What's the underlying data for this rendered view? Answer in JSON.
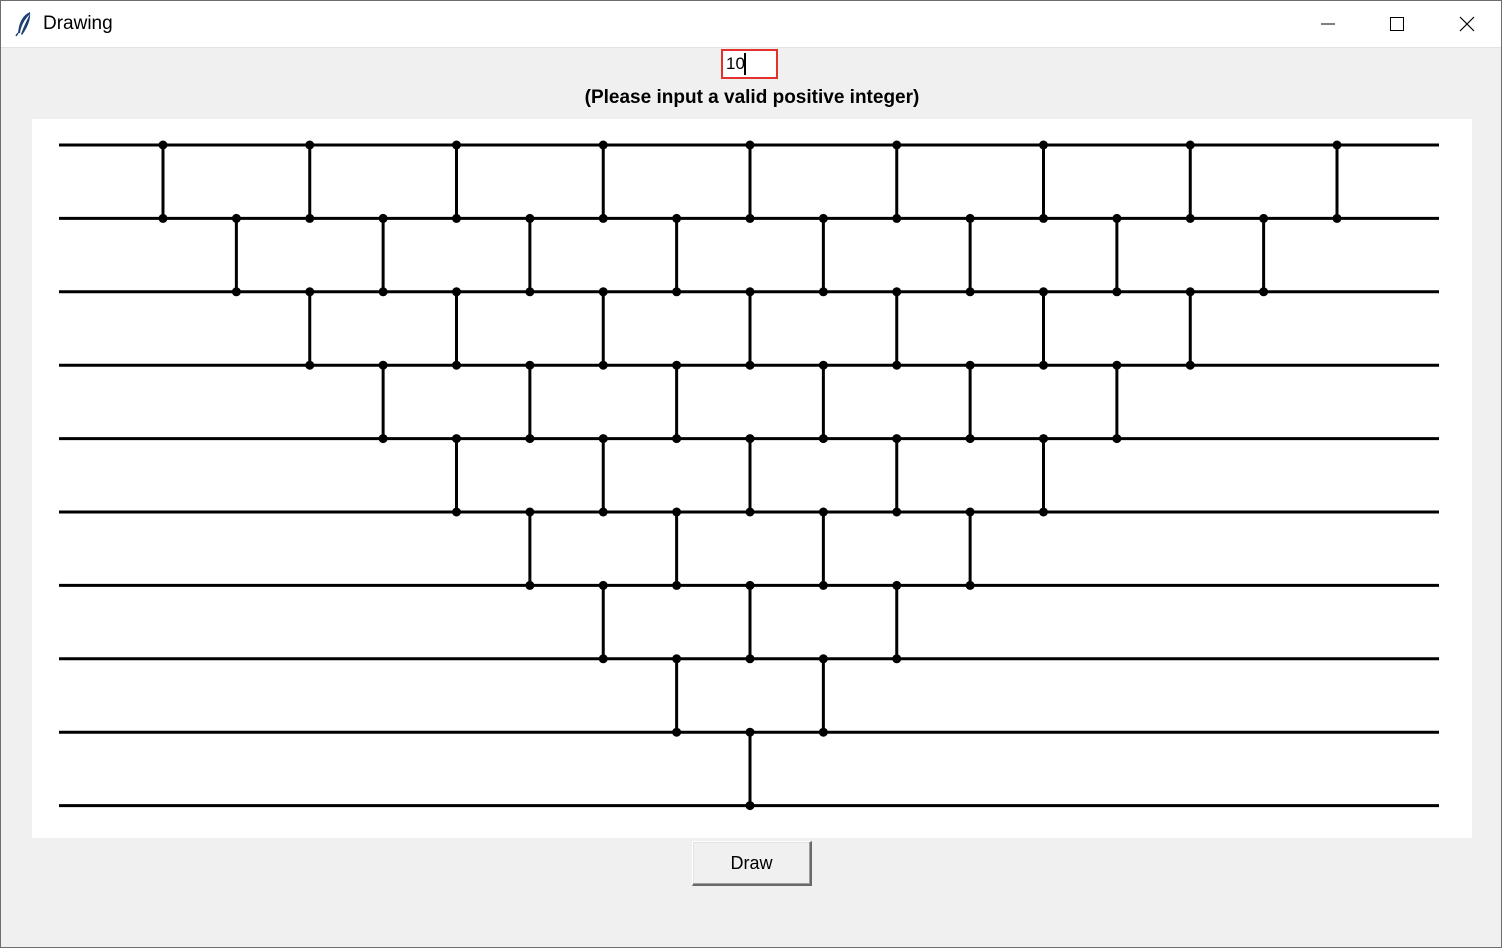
{
  "window": {
    "title": "Drawing",
    "controls": [
      "minimize-icon",
      "maximize-icon",
      "close-icon"
    ]
  },
  "form": {
    "input_value": "10",
    "hint": "(Please input a valid positive integer)",
    "draw_label": "Draw"
  },
  "colors": {
    "accent_border": "#e3312c",
    "canvas_bg": "#ffffff",
    "window_bg": "#f0f0f0",
    "ink": "#000000"
  },
  "diagram": {
    "wire_count": 10,
    "connector_columns": [
      {
        "col": 0,
        "rungs": [
          [
            0,
            1
          ]
        ]
      },
      {
        "col": 1,
        "rungs": [
          [
            1,
            2
          ]
        ]
      },
      {
        "col": 2,
        "rungs": [
          [
            0,
            1
          ],
          [
            2,
            3
          ]
        ]
      },
      {
        "col": 3,
        "rungs": [
          [
            1,
            2
          ],
          [
            3,
            4
          ]
        ]
      },
      {
        "col": 4,
        "rungs": [
          [
            0,
            1
          ],
          [
            2,
            3
          ],
          [
            4,
            5
          ]
        ]
      },
      {
        "col": 5,
        "rungs": [
          [
            1,
            2
          ],
          [
            3,
            4
          ],
          [
            5,
            6
          ]
        ]
      },
      {
        "col": 6,
        "rungs": [
          [
            0,
            1
          ],
          [
            2,
            3
          ],
          [
            4,
            5
          ],
          [
            6,
            7
          ]
        ]
      },
      {
        "col": 7,
        "rungs": [
          [
            1,
            2
          ],
          [
            3,
            4
          ],
          [
            5,
            6
          ],
          [
            7,
            8
          ]
        ]
      },
      {
        "col": 8,
        "rungs": [
          [
            0,
            1
          ],
          [
            2,
            3
          ],
          [
            4,
            5
          ],
          [
            6,
            7
          ],
          [
            8,
            9
          ]
        ]
      },
      {
        "col": 9,
        "rungs": [
          [
            1,
            2
          ],
          [
            3,
            4
          ],
          [
            5,
            6
          ],
          [
            7,
            8
          ]
        ]
      },
      {
        "col": 10,
        "rungs": [
          [
            0,
            1
          ],
          [
            2,
            3
          ],
          [
            4,
            5
          ],
          [
            6,
            7
          ]
        ]
      },
      {
        "col": 11,
        "rungs": [
          [
            1,
            2
          ],
          [
            3,
            4
          ],
          [
            5,
            6
          ]
        ]
      },
      {
        "col": 12,
        "rungs": [
          [
            0,
            1
          ],
          [
            2,
            3
          ],
          [
            4,
            5
          ]
        ]
      },
      {
        "col": 13,
        "rungs": [
          [
            1,
            2
          ],
          [
            3,
            4
          ]
        ]
      },
      {
        "col": 14,
        "rungs": [
          [
            0,
            1
          ],
          [
            2,
            3
          ]
        ]
      },
      {
        "col": 15,
        "rungs": [
          [
            1,
            2
          ]
        ]
      },
      {
        "col": 16,
        "rungs": [
          [
            0,
            1
          ]
        ]
      }
    ]
  }
}
